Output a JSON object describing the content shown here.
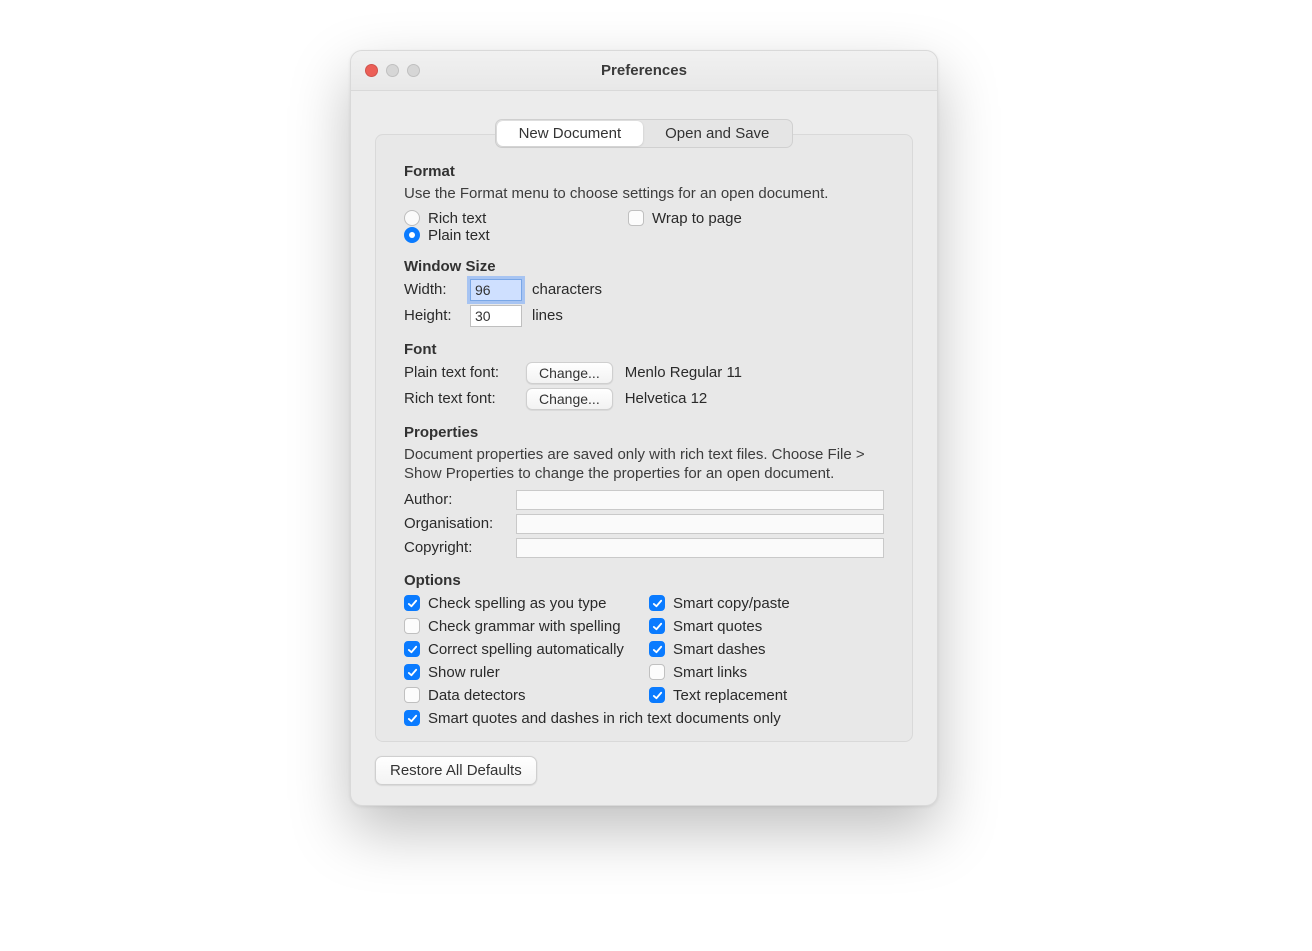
{
  "window": {
    "title": "Preferences"
  },
  "tabs": {
    "new_document": "New Document",
    "open_and_save": "Open and Save",
    "active": "new_document"
  },
  "format": {
    "heading": "Format",
    "helper": "Use the Format menu to choose settings for an open document.",
    "rich_text": "Rich text",
    "plain_text": "Plain text",
    "selected": "plain",
    "wrap_to_page": {
      "label": "Wrap to page",
      "checked": false
    }
  },
  "window_size": {
    "heading": "Window Size",
    "width_label": "Width:",
    "width_value": "96",
    "width_unit": "characters",
    "height_label": "Height:",
    "height_value": "30",
    "height_unit": "lines"
  },
  "font": {
    "heading": "Font",
    "plain_label": "Plain text font:",
    "rich_label": "Rich text font:",
    "change_btn": "Change...",
    "plain_value": "Menlo Regular 11",
    "rich_value": "Helvetica 12"
  },
  "properties": {
    "heading": "Properties",
    "helper": "Document properties are saved only with rich text files. Choose File > Show Properties to change the properties for an open document.",
    "author_label": "Author:",
    "organisation_label": "Organisation:",
    "copyright_label": "Copyright:",
    "author_value": "",
    "organisation_value": "",
    "copyright_value": ""
  },
  "options": {
    "heading": "Options",
    "left": [
      {
        "key": "check_spelling",
        "label": "Check spelling as you type",
        "checked": true
      },
      {
        "key": "check_grammar",
        "label": "Check grammar with spelling",
        "checked": false
      },
      {
        "key": "correct_spelling",
        "label": "Correct spelling automatically",
        "checked": true
      },
      {
        "key": "show_ruler",
        "label": "Show ruler",
        "checked": true
      },
      {
        "key": "data_detectors",
        "label": "Data detectors",
        "checked": false
      }
    ],
    "right": [
      {
        "key": "smart_copy",
        "label": "Smart copy/paste",
        "checked": true
      },
      {
        "key": "smart_quotes",
        "label": "Smart quotes",
        "checked": true
      },
      {
        "key": "smart_dashes",
        "label": "Smart dashes",
        "checked": true
      },
      {
        "key": "smart_links",
        "label": "Smart links",
        "checked": false
      },
      {
        "key": "text_replace",
        "label": "Text replacement",
        "checked": true
      }
    ],
    "bottom": {
      "key": "sq_rich_only",
      "label": "Smart quotes and dashes in rich text documents only",
      "checked": true
    }
  },
  "footer": {
    "restore": "Restore All Defaults"
  }
}
